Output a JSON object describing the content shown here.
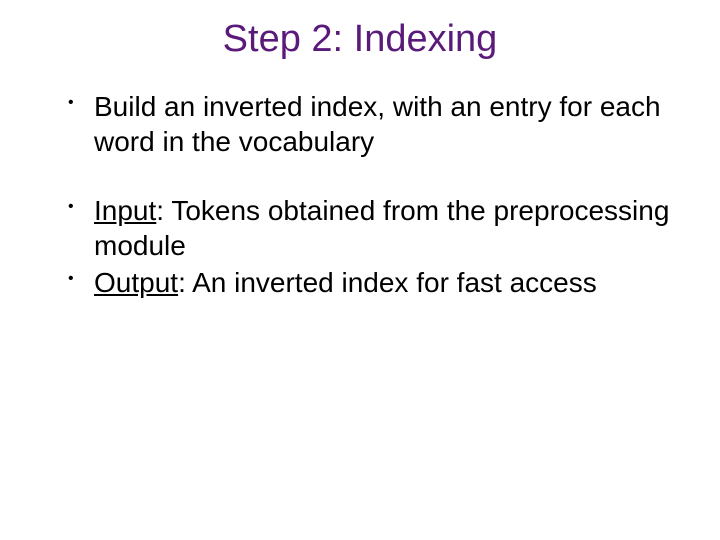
{
  "title": "Step 2: Indexing",
  "bullets": {
    "b1": "Build an inverted index, with an entry for each word in the vocabulary",
    "b2_label": "Input",
    "b2_rest": ": Tokens obtained from the preprocessing module",
    "b3_label": "Output",
    "b3_rest": ": An inverted index for fast access"
  }
}
